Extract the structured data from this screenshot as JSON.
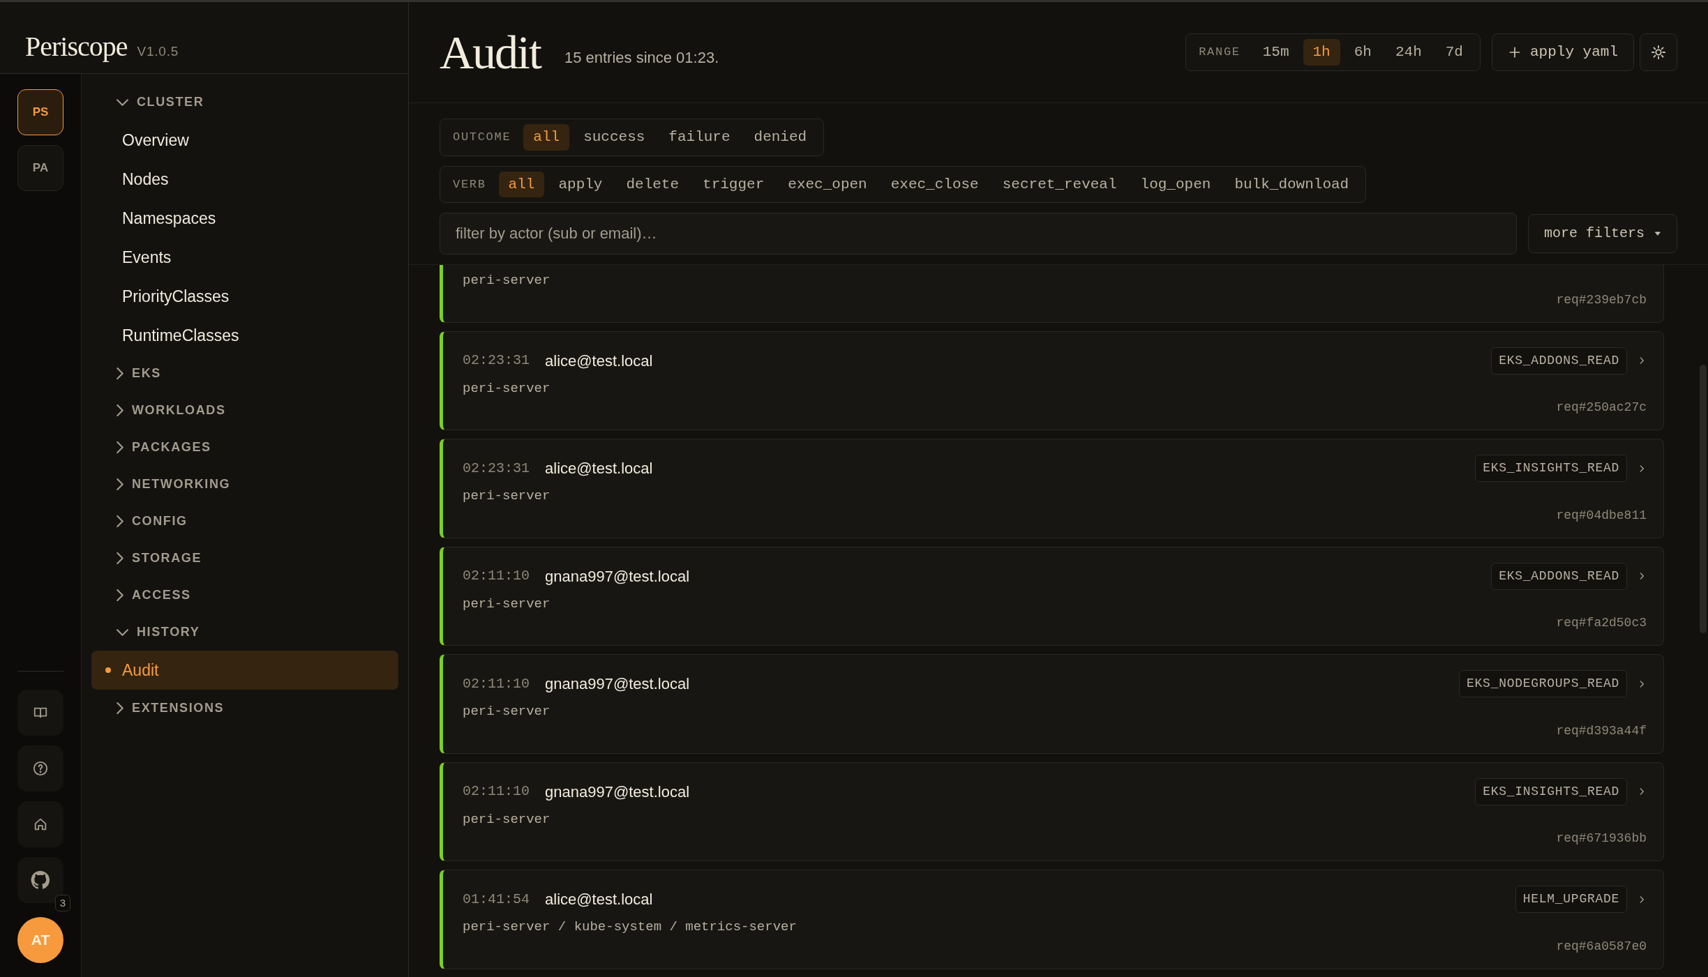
{
  "brand": {
    "name": "Periscope",
    "version": "V1.0.5"
  },
  "rail": {
    "clusters": [
      {
        "label": "PS",
        "selected": true
      },
      {
        "label": "PA",
        "selected": false
      }
    ],
    "tools": [
      {
        "kind": "book"
      },
      {
        "kind": "help"
      },
      {
        "kind": "home"
      },
      {
        "kind": "github",
        "badge": "3"
      }
    ],
    "avatar": "AT"
  },
  "nav": [
    {
      "label": "CLUSTER",
      "expanded": true,
      "children": [
        {
          "label": "Overview",
          "selected": false
        },
        {
          "label": "Nodes",
          "selected": false
        },
        {
          "label": "Namespaces",
          "selected": false
        },
        {
          "label": "Events",
          "selected": false
        },
        {
          "label": "PriorityClasses",
          "selected": false
        },
        {
          "label": "RuntimeClasses",
          "selected": false
        }
      ]
    },
    {
      "label": "EKS",
      "expanded": false
    },
    {
      "label": "WORKLOADS",
      "expanded": false
    },
    {
      "label": "PACKAGES",
      "expanded": false
    },
    {
      "label": "NETWORKING",
      "expanded": false
    },
    {
      "label": "CONFIG",
      "expanded": false
    },
    {
      "label": "STORAGE",
      "expanded": false
    },
    {
      "label": "ACCESS",
      "expanded": false
    },
    {
      "label": "HISTORY",
      "expanded": true,
      "children": [
        {
          "label": "Audit",
          "selected": true
        }
      ]
    },
    {
      "label": "EXTENSIONS",
      "expanded": false
    }
  ],
  "header": {
    "title": "Audit",
    "subtitle": "15 entries since 01:23.",
    "range": {
      "label": "RANGE",
      "options": [
        {
          "label": "15m",
          "selected": false
        },
        {
          "label": "1h",
          "selected": true
        },
        {
          "label": "6h",
          "selected": false
        },
        {
          "label": "24h",
          "selected": false
        },
        {
          "label": "7d",
          "selected": false
        }
      ]
    },
    "apply_button": "apply yaml"
  },
  "filters": {
    "outcome": {
      "label": "OUTCOME",
      "options": [
        {
          "label": "all",
          "selected": true
        },
        {
          "label": "success",
          "selected": false
        },
        {
          "label": "failure",
          "selected": false
        },
        {
          "label": "denied",
          "selected": false
        }
      ]
    },
    "verb": {
      "label": "VERB",
      "options": [
        {
          "label": "all",
          "selected": true
        },
        {
          "label": "apply",
          "selected": false
        },
        {
          "label": "delete",
          "selected": false
        },
        {
          "label": "trigger",
          "selected": false
        },
        {
          "label": "exec_open",
          "selected": false
        },
        {
          "label": "exec_close",
          "selected": false
        },
        {
          "label": "secret_reveal",
          "selected": false
        },
        {
          "label": "log_open",
          "selected": false
        },
        {
          "label": "bulk_download",
          "selected": false
        }
      ]
    },
    "actor_search": {
      "placeholder": "filter by actor (sub or email)…"
    },
    "more_button": "more filters"
  },
  "entries": [
    {
      "kind": "clipped",
      "resource": "peri-server",
      "request": "req#239eb7cb"
    },
    {
      "kind": "full",
      "time": "02:23:31",
      "actor": "alice@test.local",
      "action": "EKS_ADDONS_READ",
      "resource": "peri-server",
      "request": "req#250ac27c"
    },
    {
      "kind": "full",
      "time": "02:23:31",
      "actor": "alice@test.local",
      "action": "EKS_INSIGHTS_READ",
      "resource": "peri-server",
      "request": "req#04dbe811"
    },
    {
      "kind": "full",
      "time": "02:11:10",
      "actor": "gnana997@test.local",
      "action": "EKS_ADDONS_READ",
      "resource": "peri-server",
      "request": "req#fa2d50c3"
    },
    {
      "kind": "full",
      "time": "02:11:10",
      "actor": "gnana997@test.local",
      "action": "EKS_NODEGROUPS_READ",
      "resource": "peri-server",
      "request": "req#d393a44f"
    },
    {
      "kind": "full",
      "time": "02:11:10",
      "actor": "gnana997@test.local",
      "action": "EKS_INSIGHTS_READ",
      "resource": "peri-server",
      "request": "req#671936bb"
    },
    {
      "kind": "full",
      "time": "01:41:54",
      "actor": "alice@test.local",
      "action": "HELM_UPGRADE",
      "resource": "peri-server / kube-system / metrics-server",
      "request": "req#6a0587e0"
    }
  ]
}
